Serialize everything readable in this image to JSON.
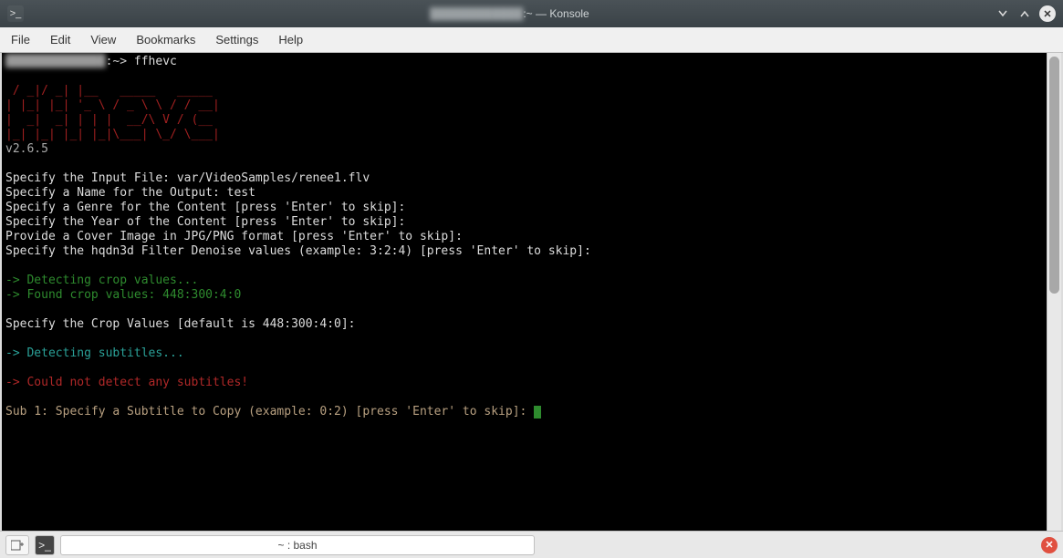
{
  "titlebar": {
    "title_suffix": ":~ — Konsole"
  },
  "menubar": {
    "file": "File",
    "edit": "Edit",
    "view": "View",
    "bookmarks": "Bookmarks",
    "settings": "Settings",
    "help": "Help"
  },
  "terminal": {
    "prompt_path": ":~>",
    "prompt_cmd": " ffhevc",
    "ascii": " / _|/ _| |__   _____   _____\n| |_| |_| '_ \\ / _ \\ \\ / / __|\n|  _|  _| | | |  __/\\ V / (__\n|_| |_| |_| |_|\\___| \\_/ \\___|",
    "version": "v2.6.5",
    "prompts": {
      "input_file_label": "Specify the Input File: ",
      "input_file_value": "var/VideoSamples/renee1.flv",
      "output_name_label": "Specify a Name for the Output: ",
      "output_name_value": "test",
      "genre": "Specify a Genre for the Content [press 'Enter' to skip]:",
      "year": "Specify the Year of the Content [press 'Enter' to skip]:",
      "cover": "Provide a Cover Image in JPG/PNG format [press 'Enter' to skip]:",
      "hqdn3d": "Specify the hqdn3d Filter Denoise values (example: 3:2:4) [press 'Enter' to skip]:",
      "crop_spec": "Specify the Crop Values [default is 448:300:4:0]:",
      "sub1": "Sub 1: Specify a Subtitle to Copy (example: 0:2) [press 'Enter' to skip]: "
    },
    "status": {
      "detecting_crop": "-> Detecting crop values...",
      "found_crop": "-> Found crop values: 448:300:4:0",
      "detecting_subs": "-> Detecting subtitles...",
      "no_subs": "-> Could not detect any subtitles!"
    }
  },
  "statusbar": {
    "tab_label": "~ : bash"
  }
}
